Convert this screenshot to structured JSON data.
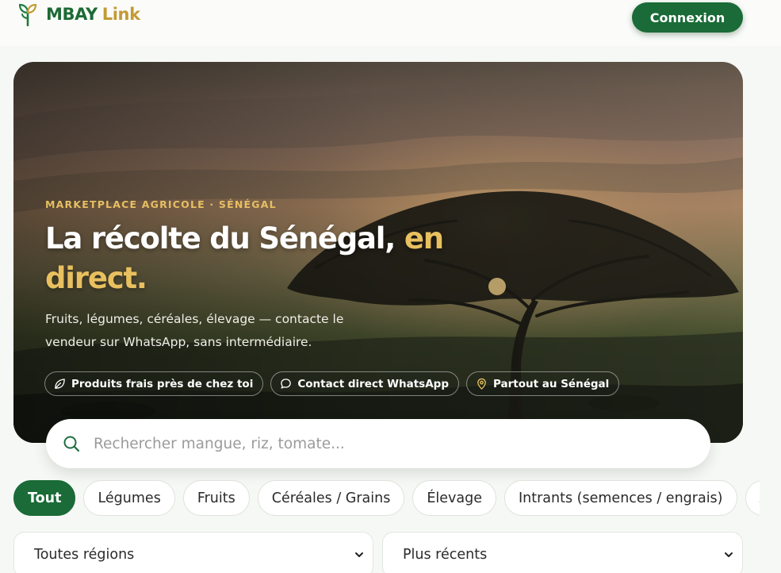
{
  "header": {
    "brand_name": "MBAY",
    "brand_suffix": "Link",
    "login_label": "Connexion"
  },
  "hero": {
    "eyebrow": "MARKETPLACE AGRICOLE · SÉNÉGAL",
    "headline_main": "La récolte du Sénégal,",
    "headline_accent": "en direct.",
    "subtitle": "Fruits, légumes, céréales, élevage — contacte le vendeur sur WhatsApp, sans intermédiaire.",
    "badges": [
      {
        "label": "Produits frais près de chez toi",
        "icon": "leaf-icon"
      },
      {
        "label": "Contact direct WhatsApp",
        "icon": "chat-bubble-icon"
      },
      {
        "label": "Partout au Sénégal",
        "icon": "map-pin-icon"
      }
    ]
  },
  "search": {
    "placeholder": "Rechercher mangue, riz, tomate...",
    "icon": "search-icon"
  },
  "categories": {
    "items": [
      "Tout",
      "Légumes",
      "Fruits",
      "Céréales / Grains",
      "Élevage",
      "Intrants (semences / engrais)",
      "A"
    ],
    "active": "Tout"
  },
  "filters": {
    "region_value": "Toutes régions",
    "sort_value": "Plus récents"
  },
  "colors": {
    "brand_green": "#1a6b37",
    "accent_gold": "#c49a33",
    "headline_gold": "#e8c05f"
  }
}
